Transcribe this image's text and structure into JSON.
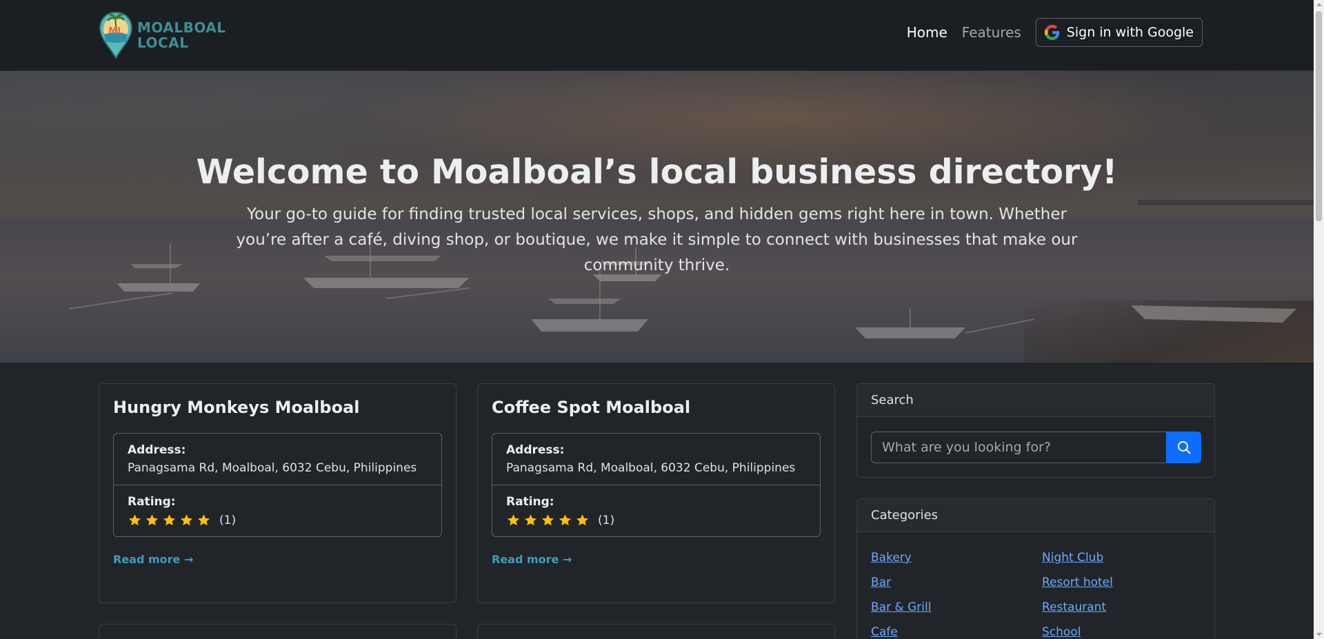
{
  "brand": {
    "line1": "MOALBOAL",
    "line2": "LOCAL",
    "logo_letters": "ML"
  },
  "nav": {
    "home": "Home",
    "features": "Features",
    "signin": "Sign in with Google"
  },
  "hero": {
    "title": "Welcome to Moalboal’s local business directory!",
    "subtitle": "Your go-to guide for finding trusted local services, shops, and hidden gems right here in town. Whether you’re after a café, diving shop, or boutique, we make it simple to connect with businesses that make our community thrive."
  },
  "listings": [
    {
      "name": "Hungry Monkeys Moalboal",
      "address_label": "Address:",
      "address": "Panagsama Rd, Moalboal, 6032 Cebu, Philippines",
      "rating_label": "Rating:",
      "rating": 5,
      "rating_count": "(1)",
      "read_more": "Read more →"
    },
    {
      "name": "Coffee Spot Moalboal",
      "address_label": "Address:",
      "address": "Panagsama Rd, Moalboal, 6032 Cebu, Philippines",
      "rating_label": "Rating:",
      "rating": 5,
      "rating_count": "(1)",
      "read_more": "Read more →"
    }
  ],
  "search": {
    "header": "Search",
    "placeholder": "What are you looking for?",
    "button_icon": "search-icon"
  },
  "categories": {
    "header": "Categories",
    "items": [
      "Bakery",
      "Night Club",
      "Bar",
      "Resort hotel",
      "Bar & Grill",
      "Restaurant",
      "Cafe",
      "School"
    ]
  },
  "colors": {
    "background": "#212529",
    "navbar": "#1b1e22",
    "accent": "#0d6efd",
    "link": "#6ea8fe",
    "read_more": "#3d9dbf",
    "star": "#ffc107",
    "brand": "#3d8f94"
  }
}
